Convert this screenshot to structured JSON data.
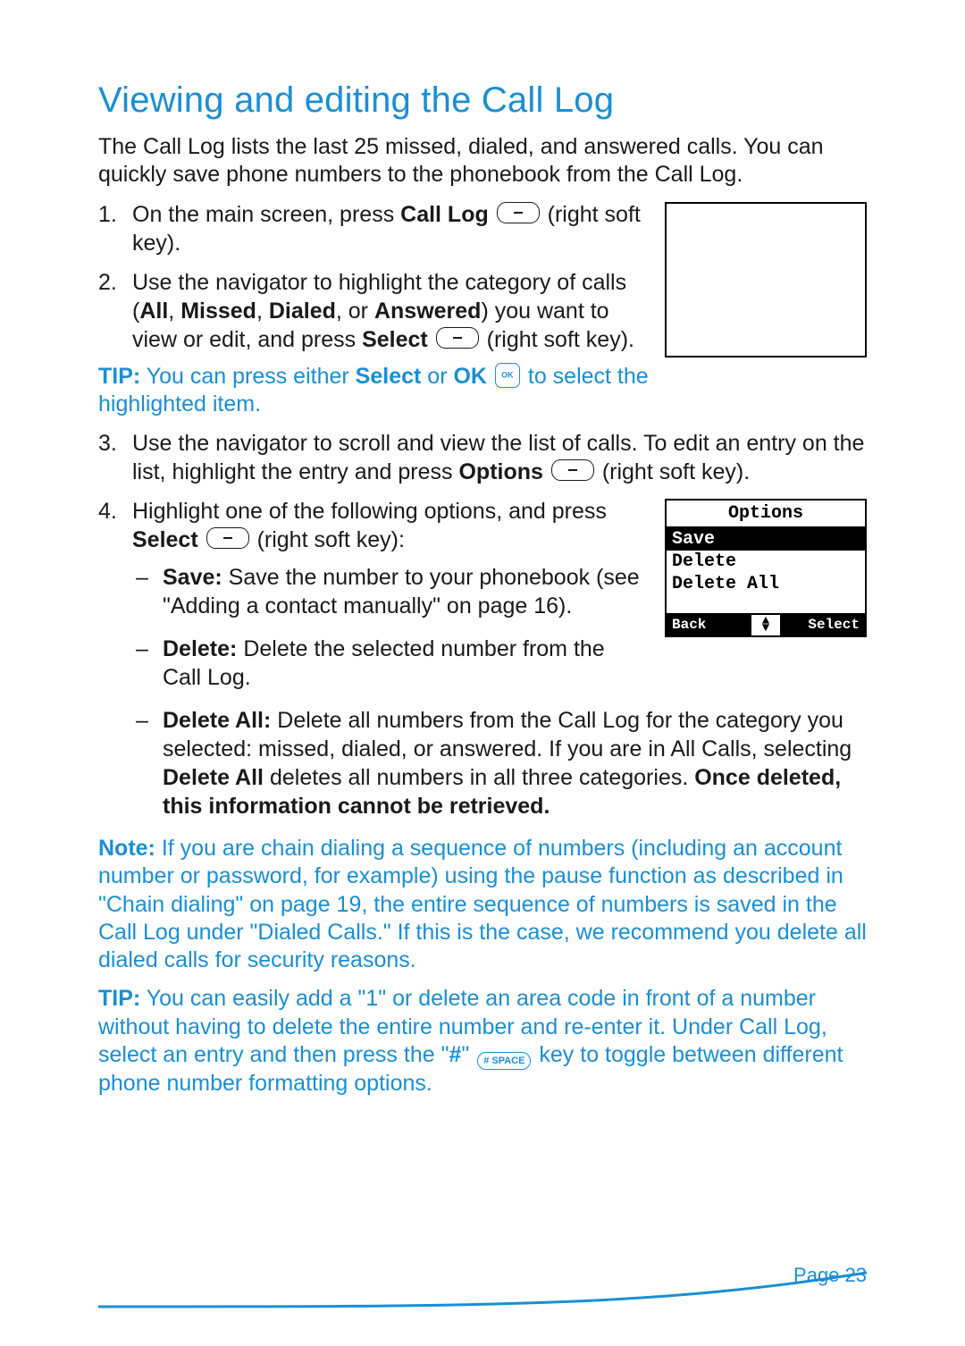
{
  "heading": "Viewing and editing the Call Log",
  "intro": "The Call Log lists the last 25 missed, dialed, and answered calls. You can quickly save phone numbers to the phonebook from the Call Log.",
  "steps": {
    "s1_a": "On the main screen, press ",
    "s1_b": "Call Log",
    "s1_c": " (right soft key).",
    "s2_a": "Use the navigator to highlight the category of calls (",
    "s2_b": "All",
    "s2_c": ", ",
    "s2_d": "Missed",
    "s2_e": ", ",
    "s2_f": "Dialed",
    "s2_g": ", or ",
    "s2_h": "Answered",
    "s2_i": ") you want to view or edit, and press ",
    "s2_j": "Select",
    "s2_k": " (right soft key).",
    "s3_a": "Use the navigator to scroll and view the list of calls. To edit an entry on the list, highlight the entry and press ",
    "s3_b": "Options",
    "s3_c": " (right soft key).",
    "s4_a": "Highlight one of the following options, and press ",
    "s4_b": "Select",
    "s4_c": " (right soft key):",
    "opt_save_l": "Save:",
    "opt_save_t": " Save the number to your phonebook (see \"Adding a contact manually\" on page 16).",
    "opt_del_l": "Delete:",
    "opt_del_t": " Delete the selected number from the Call Log.",
    "opt_da_l": "Delete All:",
    "opt_da_a": " Delete all numbers from the Call Log for the category you selected: missed, dialed, or answered. If you are in All Calls, selecting ",
    "opt_da_b": "Delete All",
    "opt_da_c": " deletes all numbers in all three categories. ",
    "opt_da_w": "Once deleted, this information cannot be retrieved."
  },
  "tip1": {
    "label": "TIP:",
    "a": " You can press either ",
    "b": "Select",
    "c": " or ",
    "d": "OK",
    "e": " to select the highlighted item."
  },
  "note": {
    "label": "Note:",
    "text": " If you are chain dialing a sequence of numbers (including an account number or password, for example) using the pause function as described in \"Chain dialing\" on page 19, the entire sequence of numbers is saved in the Call Log under \"Dialed Calls.\" If this is the case, we recommend you delete all dialed calls for security reasons."
  },
  "tip2": {
    "label": "TIP:",
    "a": " You can easily add a \"1\" or delete an area code in front of a number without having to delete the entire number and re-enter it. Under Call Log, select an entry and then press the \"",
    "b": "#",
    "c": "\" ",
    "d": " key to toggle between different phone number formatting options."
  },
  "screen2": {
    "title": "Options",
    "items": [
      "Save",
      "Delete",
      "Delete All"
    ],
    "back": "Back",
    "select": "Select"
  },
  "hashkey_label": "# SPACE",
  "page_number": "Page 23"
}
